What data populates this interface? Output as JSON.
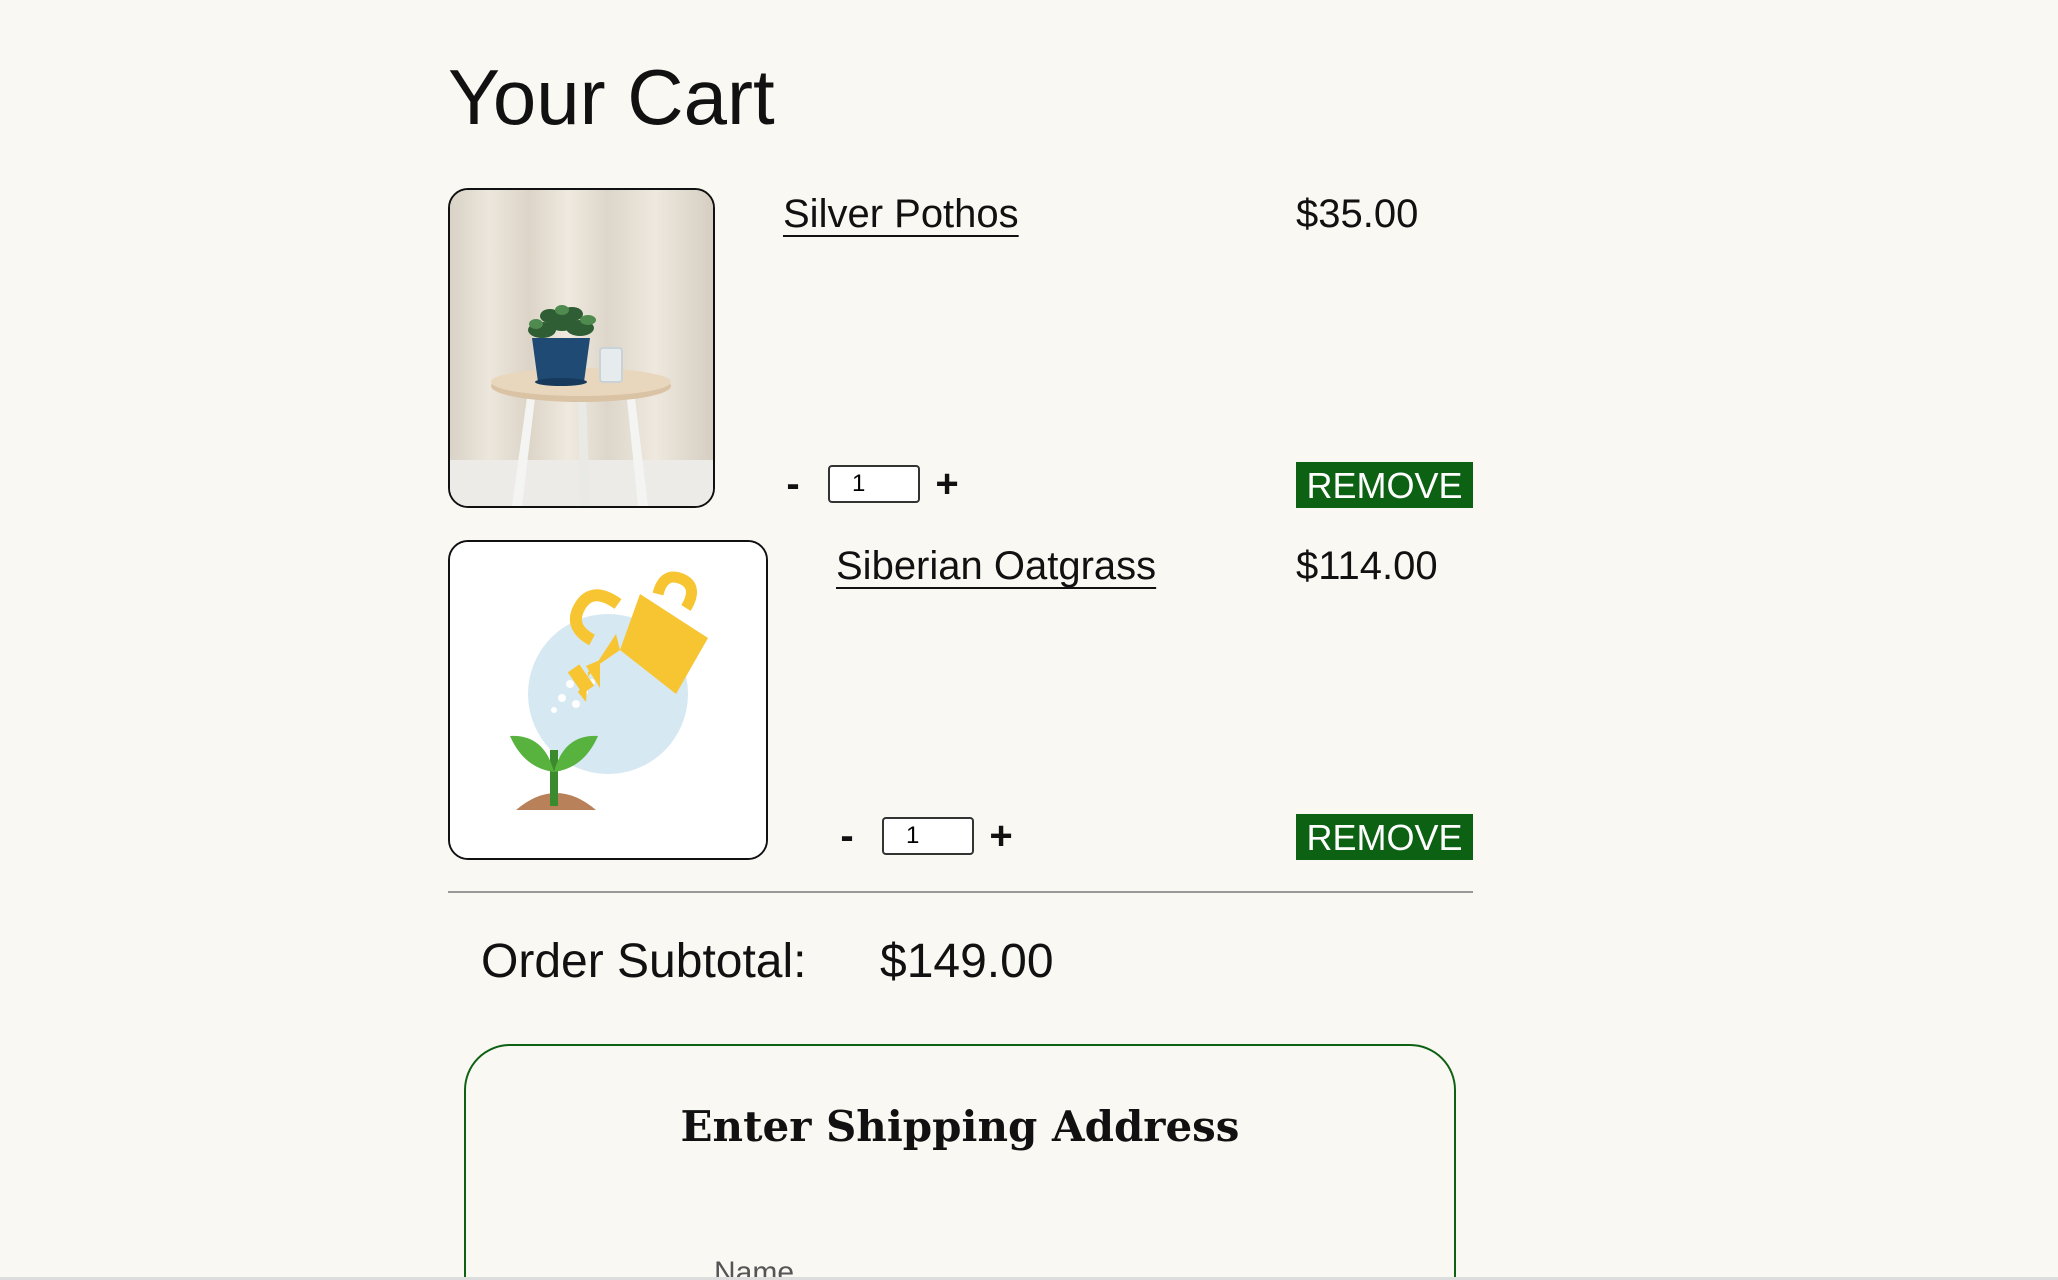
{
  "page": {
    "title": "Your Cart"
  },
  "cart": {
    "items": [
      {
        "name": "Silver Pothos",
        "price": "$35.00",
        "quantity": "1",
        "minus": "-",
        "plus": "+",
        "remove_label": "REMOVE",
        "image": "plant-on-stool-photo"
      },
      {
        "name": "Siberian Oatgrass",
        "price": "$114.00",
        "quantity": "1",
        "minus": "-",
        "plus": "+",
        "remove_label": "REMOVE",
        "image": "watering-can-sprout-illustration"
      }
    ],
    "subtotal_label": "Order Subtotal:",
    "subtotal_value": "$149.00"
  },
  "shipping": {
    "title": "Enter Shipping Address",
    "name_label": "Name"
  },
  "colors": {
    "background": "#faf8f3",
    "accent_green": "#0d6113",
    "text": "#111111"
  }
}
